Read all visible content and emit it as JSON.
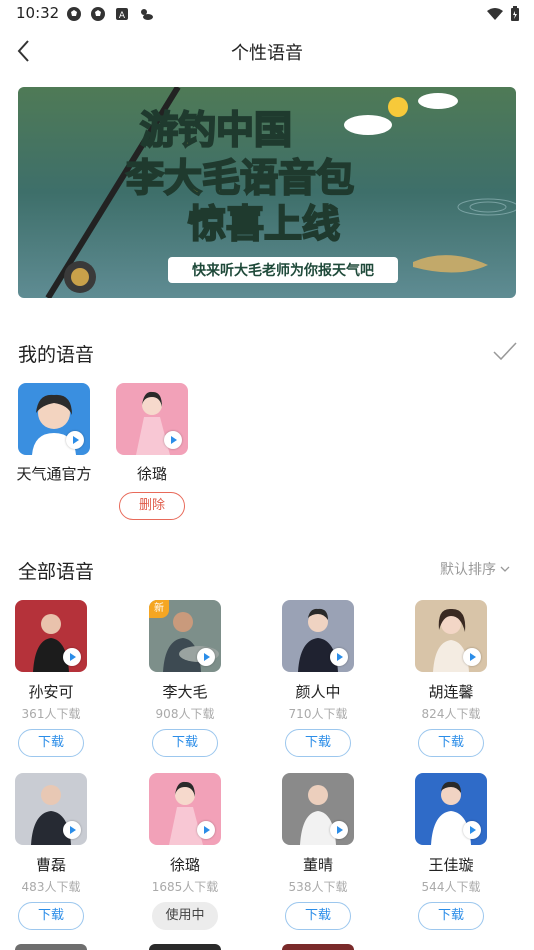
{
  "status_bar": {
    "time": "10:32",
    "icons": [
      "soccer-ball-icon",
      "soccer-ball-icon",
      "a-box-icon",
      "weather-icon"
    ],
    "right_icons": [
      "wifi-icon",
      "battery-icon"
    ]
  },
  "nav": {
    "title": "个性语音",
    "back_icon": "chevron-left-icon"
  },
  "banner": {
    "line1": "游钓中国",
    "line2": "李大毛语音包",
    "line3": "惊喜上线",
    "tagline": "快来听大毛老师为你报天气吧"
  },
  "my_voices": {
    "title": "我的语音",
    "items": [
      {
        "name": "天气通官方",
        "avatar_color": "#3a8fe0"
      },
      {
        "name": "徐璐",
        "avatar_color": "#f2a1b8",
        "action": "删除"
      }
    ]
  },
  "all_voices": {
    "title": "全部语音",
    "sort_label": "默认排序",
    "items": [
      {
        "name": "孙安可",
        "count": "361人下载",
        "action": "下载",
        "avatar_color": "#b5323a"
      },
      {
        "name": "李大毛",
        "count": "908人下载",
        "action": "下载",
        "avatar_color": "#7d8f8a",
        "badge": "新"
      },
      {
        "name": "颜人中",
        "count": "710人下载",
        "action": "下载",
        "avatar_color": "#9aa2b5"
      },
      {
        "name": "胡连馨",
        "count": "824人下载",
        "action": "下载",
        "avatar_color": "#d8c4a8"
      },
      {
        "name": "曹磊",
        "count": "483人下载",
        "action": "下载",
        "avatar_color": "#c9ccd3"
      },
      {
        "name": "徐璐",
        "count": "1685人下载",
        "action": "使用中",
        "avatar_color": "#f2a1b8"
      },
      {
        "name": "董晴",
        "count": "538人下载",
        "action": "下载",
        "avatar_color": "#8a8a8a"
      },
      {
        "name": "王佳璇",
        "count": "544人下载",
        "action": "下载",
        "avatar_color": "#2f6bc8"
      }
    ]
  }
}
